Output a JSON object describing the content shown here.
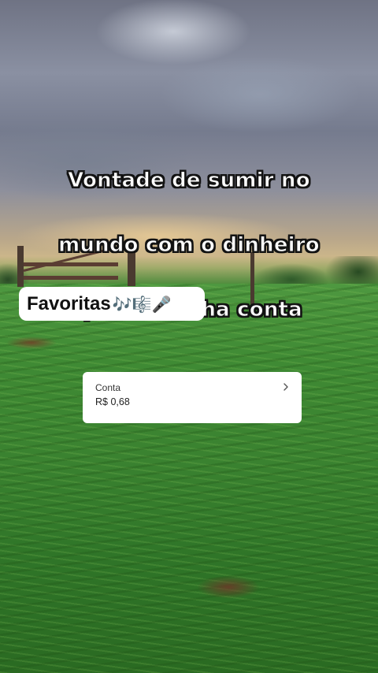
{
  "caption": {
    "lines": [
      "Vontade de sumir no",
      "mundo com o dinheiro",
      "que tá minha conta"
    ]
  },
  "favorites_label": {
    "text": "Favoritas",
    "emojis": "🎶🎼🎤"
  },
  "account_card": {
    "title": "Conta",
    "balance": "R$ 0,68",
    "chevron_icon": "chevron-right-icon"
  },
  "colors": {
    "caption_text": "#ffffff",
    "caption_outline": "#111111",
    "card_background": "#ffffff"
  }
}
